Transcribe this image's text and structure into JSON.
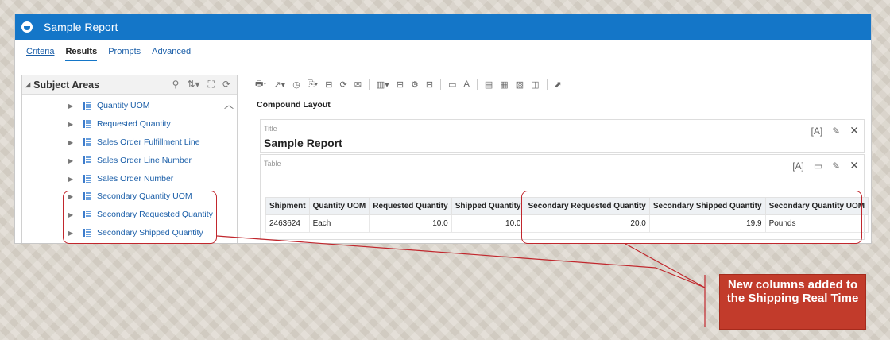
{
  "window": {
    "title": "Sample Report"
  },
  "tabs": [
    {
      "label": "Criteria"
    },
    {
      "label": "Results"
    },
    {
      "label": "Prompts"
    },
    {
      "label": "Advanced"
    }
  ],
  "subject_areas": {
    "header": "Subject Areas",
    "items": [
      {
        "label": "Quantity UOM"
      },
      {
        "label": "Requested Quantity"
      },
      {
        "label": "Sales Order Fulfillment Line"
      },
      {
        "label": "Sales Order Line Number"
      },
      {
        "label": "Sales Order Number"
      },
      {
        "label": "Secondary Quantity UOM"
      },
      {
        "label": "Secondary Requested Quantity"
      },
      {
        "label": "Secondary Shipped Quantity"
      }
    ]
  },
  "layout": {
    "name": "Compound Layout"
  },
  "title_view": {
    "label": "Title",
    "text": "Sample Report"
  },
  "table_view": {
    "label": "Table",
    "columns": [
      "Shipment",
      "Quantity UOM",
      "Requested Quantity",
      "Shipped Quantity",
      "Secondary Requested Quantity",
      "Secondary Shipped Quantity",
      "Secondary Quantity UOM"
    ],
    "rows": [
      [
        "2463624",
        "Each",
        "10.0",
        "10.0",
        "20.0",
        "19.9",
        "Pounds"
      ]
    ]
  },
  "callout": {
    "text": "New columns added to the Shipping Real Time"
  },
  "colors": {
    "brand": "#1476c8",
    "highlight": "#c1272d",
    "callout_bg": "#c23b2b"
  }
}
